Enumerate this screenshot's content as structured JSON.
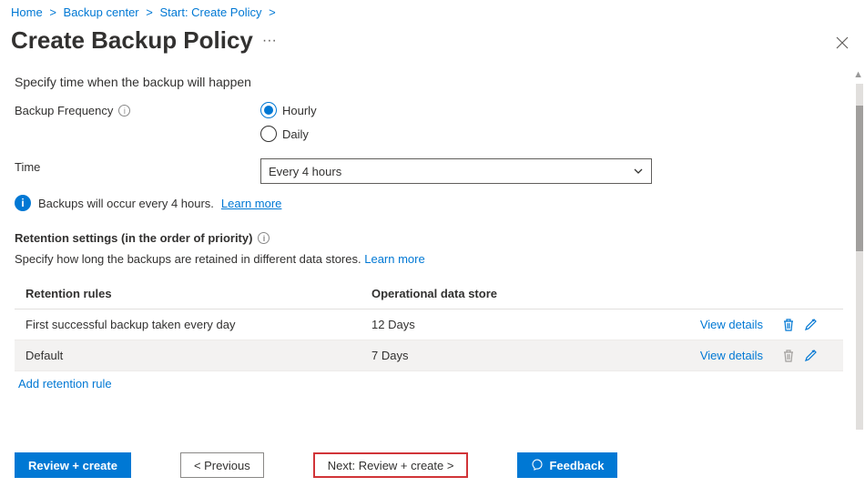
{
  "breadcrumb": [
    {
      "label": "Home"
    },
    {
      "label": "Backup center"
    },
    {
      "label": "Start: Create Policy"
    }
  ],
  "page_title": "Create Backup Policy",
  "subheader": "Specify time when the backup will happen",
  "backup_frequency": {
    "label": "Backup Frequency",
    "options": {
      "hourly": "Hourly",
      "daily": "Daily"
    },
    "selected": "hourly"
  },
  "time": {
    "label": "Time",
    "value": "Every 4 hours"
  },
  "info_banner": {
    "text": "Backups will occur every 4 hours.",
    "link": "Learn more"
  },
  "retention": {
    "title": "Retention settings (in the order of priority)",
    "sub": "Specify how long the backups are retained in different data stores.",
    "sub_link": "Learn more",
    "columns": {
      "rule": "Retention rules",
      "store": "Operational data store"
    },
    "rows": [
      {
        "rule": "First successful backup taken every day",
        "store": "12 Days",
        "view": "View details",
        "delete_enabled": true
      },
      {
        "rule": "Default",
        "store": "7 Days",
        "view": "View details",
        "delete_enabled": false
      }
    ],
    "add": "Add retention rule"
  },
  "footer": {
    "review": "Review + create",
    "previous": "< Previous",
    "next": "Next: Review + create >",
    "feedback": "Feedback"
  }
}
